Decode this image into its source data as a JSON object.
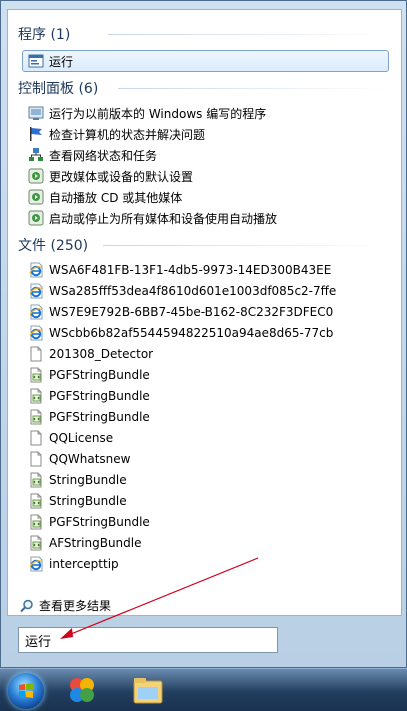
{
  "groups": {
    "programs": {
      "header": "程序 (1)",
      "items": [
        {
          "label": "运行",
          "icon": "run-icon"
        }
      ]
    },
    "control_panel": {
      "header": "控制面板 (6)",
      "items": [
        {
          "label": "运行为以前版本的 Windows 编写的程序",
          "icon": "compatibility-icon"
        },
        {
          "label": "检查计算机的状态并解决问题",
          "icon": "action-center-flag-icon"
        },
        {
          "label": "查看网络状态和任务",
          "icon": "network-icon"
        },
        {
          "label": "更改媒体或设备的默认设置",
          "icon": "autoplay-icon"
        },
        {
          "label": "自动播放 CD 或其他媒体",
          "icon": "autoplay-icon"
        },
        {
          "label": "启动或停止为所有媒体和设备使用自动播放",
          "icon": "autoplay-icon"
        }
      ]
    },
    "files": {
      "header": "文件 (250)",
      "items": [
        {
          "label": "WSA6F481FB-13F1-4db5-9973-14ED300B43EE",
          "icon": "ie-file-icon"
        },
        {
          "label": "WSa285fff53dea4f8610d601e1003df085c2-7ffe",
          "icon": "ie-file-icon"
        },
        {
          "label": "WS7E9E792B-6BB7-45be-B162-8C232F3DFEC0",
          "icon": "ie-file-icon"
        },
        {
          "label": "WScbb6b82af5544594822510a94ae8d65-77cb",
          "icon": "ie-file-icon"
        },
        {
          "label": "201308_Detector",
          "icon": "document-icon"
        },
        {
          "label": "PGFStringBundle",
          "icon": "xml-file-icon"
        },
        {
          "label": "PGFStringBundle",
          "icon": "xml-file-icon"
        },
        {
          "label": "PGFStringBundle",
          "icon": "xml-file-icon"
        },
        {
          "label": "QQLicense",
          "icon": "document-icon"
        },
        {
          "label": "QQWhatsnew",
          "icon": "document-icon"
        },
        {
          "label": "StringBundle",
          "icon": "xml-file-icon"
        },
        {
          "label": "StringBundle",
          "icon": "xml-file-icon"
        },
        {
          "label": "PGFStringBundle",
          "icon": "xml-file-icon"
        },
        {
          "label": "AFStringBundle",
          "icon": "xml-file-icon"
        },
        {
          "label": "intercepttip",
          "icon": "ie-file-icon"
        }
      ]
    }
  },
  "see_more": "查看更多结果",
  "search": {
    "value": "运行"
  },
  "taskbar": {
    "icons": [
      "start-orb",
      "app-icon",
      "explorer-icon"
    ]
  },
  "colors": {
    "header_text": "#1e395b",
    "selection_border": "#7da2ce",
    "annotation_arrow": "#d0021b"
  }
}
